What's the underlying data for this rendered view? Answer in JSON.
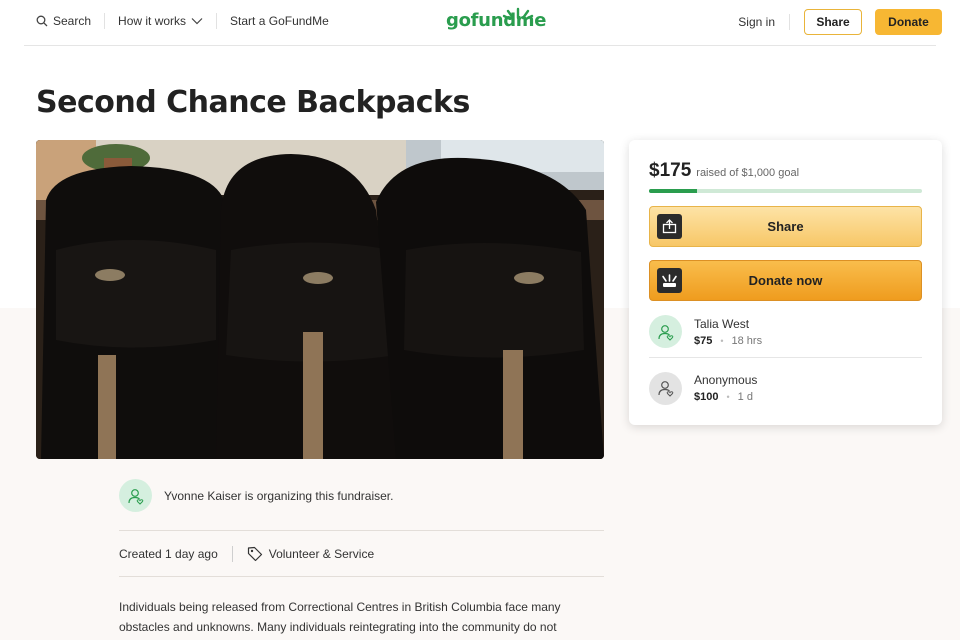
{
  "header": {
    "search_label": "Search",
    "how_it_works_label": "How it works",
    "start_label": "Start a GoFundMe",
    "logo_text": "gofundme",
    "signin_label": "Sign in",
    "share_label": "Share",
    "donate_label": "Donate"
  },
  "campaign": {
    "title": "Second Chance Backpacks",
    "raised": "$175",
    "goal_text": "raised of $1,000 goal",
    "progress_fraction": 0.175,
    "share_button": "Share",
    "donate_button": "Donate now"
  },
  "donors": [
    {
      "name": "Talia West",
      "amount": "$75",
      "time": "18 hrs"
    },
    {
      "name": "Anonymous",
      "amount": "$100",
      "time": "1 d"
    }
  ],
  "organizer": {
    "text": "Yvonne Kaiser is organizing this fundraiser."
  },
  "meta": {
    "created": "Created 1 day ago",
    "category": "Volunteer & Service"
  },
  "description": "Individuals being released from Correctional Centres in British Columbia face many obstacles and unknowns. Many individuals reintegrating into the community do not",
  "colors": {
    "brand_green": "#2a9d4e",
    "donate_orange": "#f7b733"
  },
  "icons": [
    "search-icon",
    "chevron-down-icon",
    "share-icon",
    "donate-icon",
    "user-heart-icon",
    "tag-icon"
  ]
}
